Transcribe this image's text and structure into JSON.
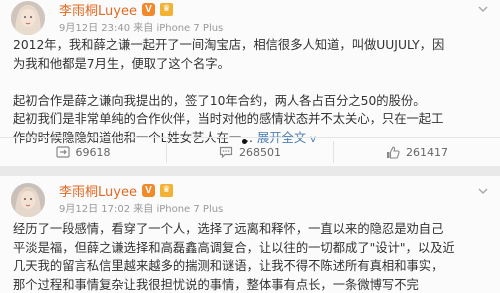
{
  "posts": [
    {
      "author": "李雨桐Luyee",
      "verified_badge": "V",
      "meta": "9月12日 23:40 来自 iPhone 7 Plus",
      "lines": [
        "2012年，我和薛之谦一起开了一间淘宝店，相信很多人知道，叫做UUJULY，因",
        "为我和他都是7月生，便取了这个名字。",
        "",
        "起初合作是薛之谦向我提出的，签了10年合约，两人各占百分之50的股份。",
        "起初我们是非常单纯的合作伙伴，当时对他的感情状态并不太关心，只在一起工",
        "作的时候隐隐知道他和一个L姓女艺人在一..."
      ],
      "expand_label": "展开全文",
      "expand_arrow": "v",
      "actions": {
        "repost_count": "69618",
        "comment_count": "268501",
        "like_count": "261417"
      }
    },
    {
      "author": "李雨桐Luyee",
      "verified_badge": "V",
      "meta": "9月12日 17:02 来自 iPhone 7 Plus",
      "lines": [
        "经历了一段感情，看穿了一个人，选择了远离和释怀，一直以来的隐忍是劝自己",
        "平淡是福，但薛之谦选择和高磊鑫高调复合，让以往的一切都成了\"设计\"，以及近",
        "几天我的留言私信里越来越多的揣测和谜语，让我不得不陈述所有真相和事实，",
        "那个过程和事情复杂让我很担忧说的事情，整体事有点长，一条微博写不完"
      ]
    }
  ],
  "icons": {
    "repost": "repost-icon",
    "comment": "comment-icon",
    "like": "thumbs-up-icon",
    "more": "chevron-down-icon"
  },
  "colors": {
    "author_name": "#e06a23",
    "link": "#4a7fb5",
    "meta": "#999999"
  }
}
